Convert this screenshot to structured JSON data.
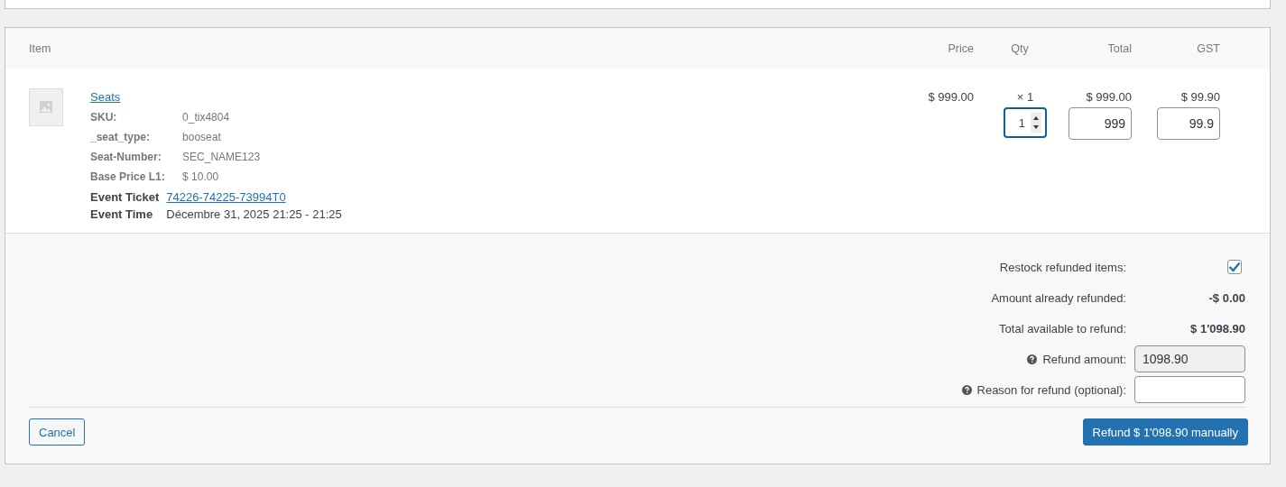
{
  "table": {
    "columns": [
      {
        "label": "Item"
      },
      {
        "label": "Price"
      },
      {
        "label": "Qty"
      },
      {
        "label": "Total"
      },
      {
        "label": "GST"
      }
    ],
    "item": {
      "name": "Seats",
      "meta": [
        {
          "label": "SKU:",
          "value": "0_tix4804"
        },
        {
          "label": "_seat_type:",
          "value": "booseat"
        },
        {
          "label": "Seat-Number:",
          "value": "SEC_NAME123"
        },
        {
          "label": "Base Price L1:",
          "value": "$ 10.00"
        }
      ],
      "event": [
        {
          "kind": "link",
          "label": "Event Ticket",
          "value": "74226-74225-73994T0"
        },
        {
          "kind": "text",
          "label": "Event Time",
          "value": "Décembre 31, 2025 21:25 - 21:25"
        }
      ],
      "price": "$ 999.00",
      "qty": "× 1",
      "qty_input": "1",
      "total": "$ 999.00",
      "total_input": "999",
      "gst": "$ 99.90",
      "gst_input": "99.9"
    }
  },
  "refund": {
    "restock": {
      "label": "Restock refunded items:",
      "checked": true
    },
    "already": {
      "label": "Amount already refunded:",
      "value": "-$ 0.00"
    },
    "available": {
      "label": "Total available to refund:",
      "value": "$ 1'098.90"
    },
    "amount": {
      "label": "Refund amount:",
      "value": "1098.90"
    },
    "reason": {
      "label": "Reason for refund (optional):"
    }
  },
  "buttons": {
    "cancel": "Cancel",
    "refund": "Refund $ 1'098.90 manually"
  }
}
